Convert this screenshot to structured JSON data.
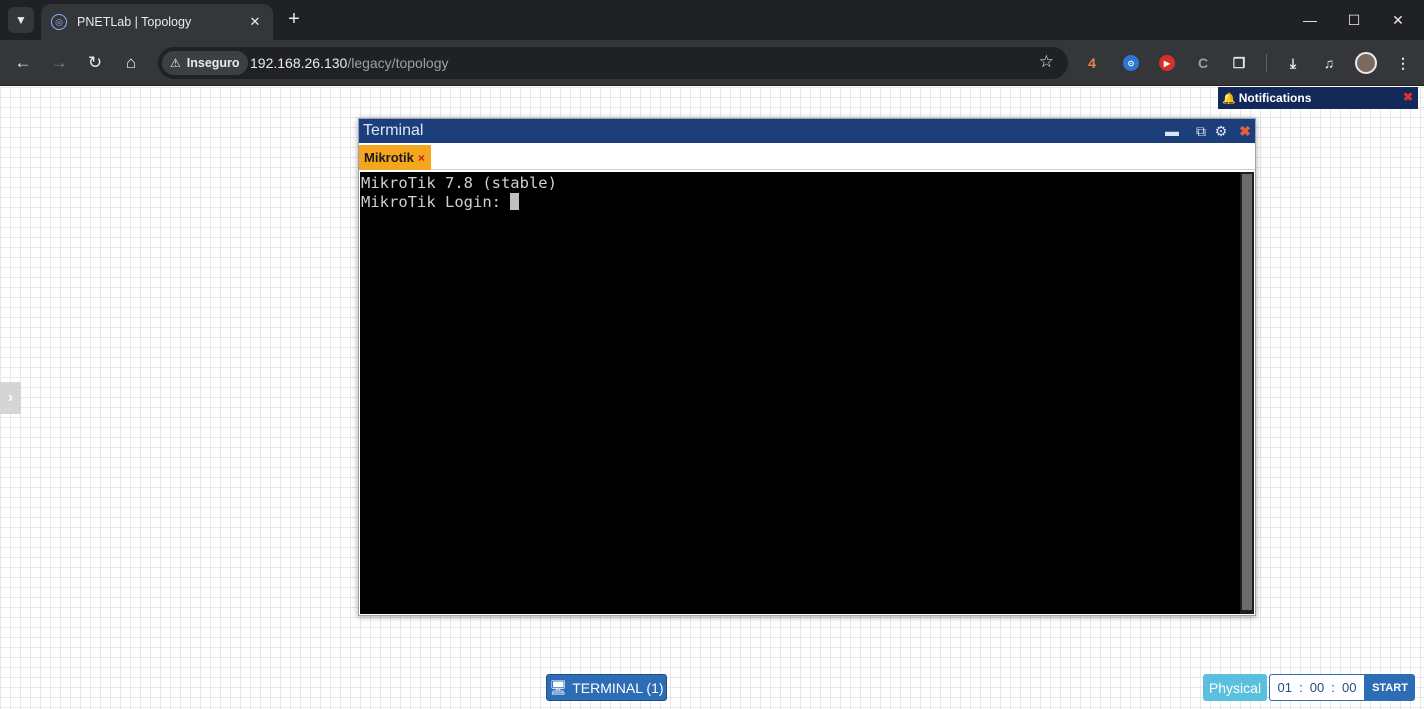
{
  "browser": {
    "tab_title": "PNETLab | Topology",
    "tab_close": "✕",
    "new_tab": "+",
    "security_label": "Inseguro",
    "url_host": "192.168.26.130",
    "url_path": "/legacy/topology",
    "extension_badge": "4",
    "window_controls": {
      "minimize": "—",
      "maximize": "☐",
      "close": "✕"
    }
  },
  "notifications": {
    "title": "Notifications",
    "close": "✖"
  },
  "terminal_window": {
    "title": "Terminal",
    "tab_label": "Mikrotik",
    "tab_close": "×",
    "lines": [
      "MikroTik 7.8 (stable)",
      "MikroTik Login: "
    ]
  },
  "bottom_bar": {
    "terminal_button": "TERMINAL (1)",
    "physical_button": "Physical",
    "timer": {
      "hours": "01",
      "minutes": "00",
      "seconds": "00",
      "separator": ":"
    },
    "start_button": "START"
  },
  "colors": {
    "terminal_titlebar": "#1c3f7c",
    "tab_accent": "#f5a51e",
    "primary_button": "#2d6db5",
    "physical_button": "#5bc0de"
  }
}
